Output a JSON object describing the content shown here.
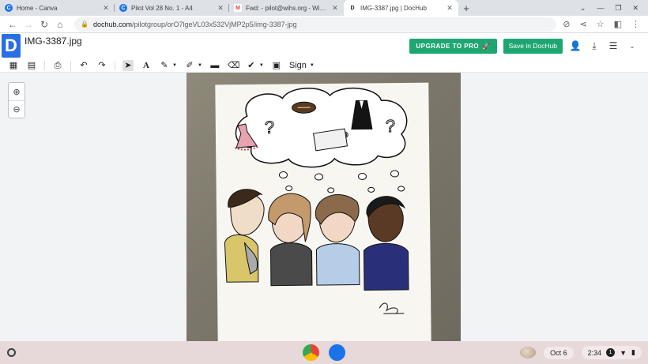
{
  "browser": {
    "tabs": [
      {
        "title": "Home - Canva",
        "favicon": "canva-icon",
        "color": "#1a73e8",
        "active": false
      },
      {
        "title": "Pilot Vol 28 No. 1 - A4",
        "favicon": "canva-icon",
        "color": "#1a73e8",
        "active": false
      },
      {
        "title": "Fwd: - pilot@wihs.org - Wisconsin",
        "favicon": "gmail-icon",
        "color": "#ea4335",
        "active": false
      },
      {
        "title": "IMG-3387.jpg | DocHub",
        "favicon": "dochub-icon",
        "color": "#2a6ee4",
        "active": true
      }
    ],
    "new_tab_label": "+",
    "address": {
      "host": "dochub.com",
      "path": "/pilotgroup/orO7lgeVL03x532VjMP2p5/img-3387-jpg"
    }
  },
  "dochub": {
    "logo_letter": "D",
    "filename": "IMG-3387.jpg",
    "upgrade_label": "UPGRADE TO PRO",
    "save_label": "Save in DocHub",
    "sign_label": "Sign",
    "accent": "#1ea672",
    "brand": "#2a6ee4"
  },
  "shelf": {
    "date": "Oct 6",
    "time": "2:34",
    "notification_count": "1"
  }
}
